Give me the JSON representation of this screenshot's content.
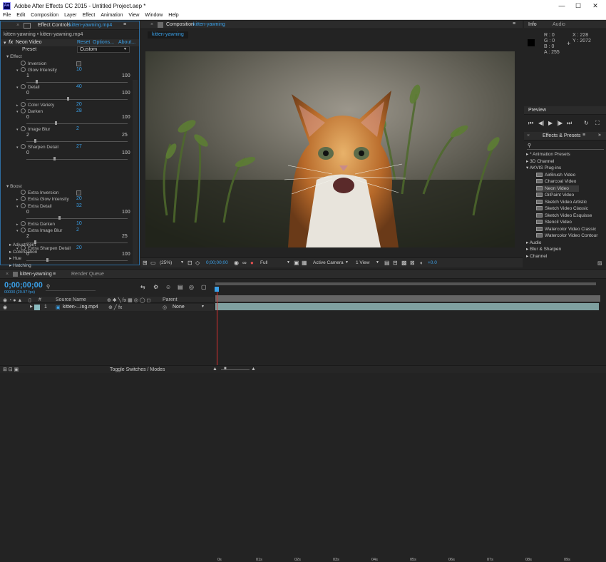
{
  "app": {
    "title": "Adobe After Effects CC 2015 - Untitled Project.aep *",
    "logo": "Ae"
  },
  "menu": [
    "File",
    "Edit",
    "Composition",
    "Layer",
    "Effect",
    "Animation",
    "View",
    "Window",
    "Help"
  ],
  "effect_controls": {
    "tab_label": "Effect Controls",
    "tab_file": "kitten-yawning.mp4",
    "crumb": "kitten-yawning • kitten-yawning.mp4",
    "effect_name": "Neon Video",
    "reset": "Reset",
    "options": "Options...",
    "about": "About...",
    "preset_label": "Preset",
    "preset_value": "Custom",
    "effect_group": "Effect",
    "boost_group": "Boost",
    "params": [
      {
        "name": "Inversion",
        "value": "",
        "min": "",
        "max": ""
      },
      {
        "name": "Glow Intensity",
        "value": "10",
        "min": "1",
        "max": "100"
      },
      {
        "name": "Detail",
        "value": "40",
        "min": "0",
        "max": "100"
      },
      {
        "name": "Color Variety",
        "value": "20",
        "min": "",
        "max": ""
      },
      {
        "name": "Darken",
        "value": "28",
        "min": "0",
        "max": "100"
      },
      {
        "name": "Image Blur",
        "value": "2",
        "min": "2",
        "max": "25"
      },
      {
        "name": "Sharpen Detail",
        "value": "27",
        "min": "0",
        "max": "100"
      },
      {
        "name": "Extra Inversion",
        "value": "",
        "min": "",
        "max": ""
      },
      {
        "name": "Extra Glow Intensity",
        "value": "20",
        "min": "",
        "max": ""
      },
      {
        "name": "Extra Detail",
        "value": "32",
        "min": "0",
        "max": "100"
      },
      {
        "name": "Extra Darken",
        "value": "10",
        "min": "",
        "max": ""
      },
      {
        "name": "Extra Image Blur",
        "value": "2",
        "min": "2",
        "max": "25"
      },
      {
        "name": "Extra Sharpen Detail",
        "value": "20",
        "min": "0",
        "max": "100"
      }
    ],
    "footer_groups": [
      "Adjustment",
      "Colorization",
      "Hue",
      "Hatching"
    ]
  },
  "composition": {
    "tab_label": "Composition",
    "tab_name": "kitten-yawning",
    "comp_tab": "kitten-yawning",
    "zoom": "(25%)",
    "timecode": "0;00;00;00",
    "resolution": "Full",
    "camera": "Active Camera",
    "views": "1 View",
    "exposure": "+0.0"
  },
  "info": {
    "tab": "Info",
    "tab2": "Audio",
    "r": "R : 0",
    "g": "G : 0",
    "b": "B : 0",
    "a": "A : 255",
    "x": "X : 228",
    "y": "Y : 2072"
  },
  "preview": {
    "tab": "Preview"
  },
  "effects_presets": {
    "tab": "Effects & Presets",
    "search_placeholder": "",
    "items": [
      {
        "label": "* Animation Presets",
        "level": 0,
        "open": false
      },
      {
        "label": "3D Channel",
        "level": 0,
        "open": false
      },
      {
        "label": "AKVIS Plug-ins",
        "level": 0,
        "open": true
      },
      {
        "label": "AirBrush Video",
        "level": 1
      },
      {
        "label": "Charcoal Video",
        "level": 1
      },
      {
        "label": "Neon Video",
        "level": 1,
        "selected": true
      },
      {
        "label": "OilPaint Video",
        "level": 1
      },
      {
        "label": "Sketch Video Artistic",
        "level": 1
      },
      {
        "label": "Sketch Video Classic",
        "level": 1
      },
      {
        "label": "Sketch Video Esquisse",
        "level": 1
      },
      {
        "label": "Stencil Video",
        "level": 1
      },
      {
        "label": "Watercolor Video Classic",
        "level": 1
      },
      {
        "label": "Watercolor Video Contour",
        "level": 1
      },
      {
        "label": "Audio",
        "level": 0,
        "open": false
      },
      {
        "label": "Blur & Sharpen",
        "level": 0,
        "open": false
      },
      {
        "label": "Channel",
        "level": 0,
        "open": false
      }
    ]
  },
  "timeline": {
    "tab": "kitten-yawning",
    "render_queue": "Render Queue",
    "timecode": "0;00;00;00",
    "fps": "00000 (29.97 fps)",
    "col_source": "Source Name",
    "col_parent": "Parent",
    "layer_num": "1",
    "layer_name": "kitten-...ing.mp4",
    "parent_value": "None",
    "ticks": [
      "0s",
      "01s",
      "02s",
      "03s",
      "04s",
      "05s",
      "06s",
      "07s",
      "08s",
      "09s"
    ],
    "toggle": "Toggle Switches / Modes"
  },
  "colors": {
    "accent": "#3aa0e8",
    "bg": "#232323",
    "playhead": "#d83030",
    "layer_bar": "#7fa0a0"
  }
}
